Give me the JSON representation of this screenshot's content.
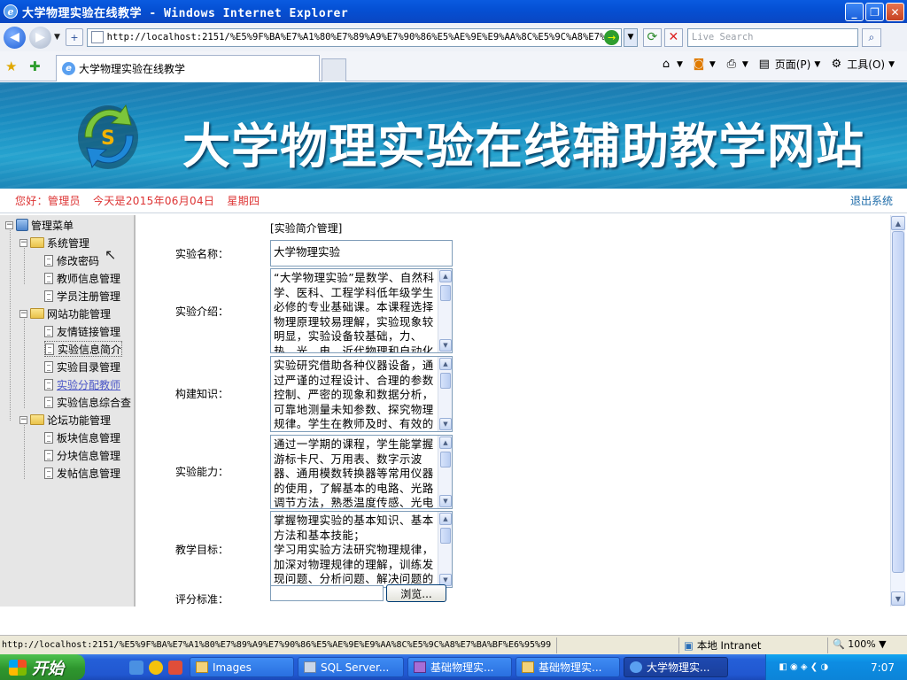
{
  "window": {
    "title": "大学物理实验在线教学 - Windows Internet Explorer",
    "buttons": {
      "minimize": "_",
      "maximize": "❐",
      "close": "✕"
    }
  },
  "address": {
    "url": "http://localhost:2151/%E5%9F%BA%E7%A1%80%E7%89%A9%E7%90%86%E5%AE%9E%E9%AA%8C%E5%9C%A8%E7%BA",
    "search_placeholder": "Live Search"
  },
  "tab": {
    "label": "大学物理实验在线教学"
  },
  "commandbar": {
    "page": "页面(P)",
    "tools": "工具(O)"
  },
  "banner": {
    "title": "大学物理实验在线辅助教学网站"
  },
  "welcome": {
    "greeting": "您好：管理员",
    "date": "今天是2015年06月04日",
    "weekday": "星期四",
    "logout": "退出系统"
  },
  "sidebar": {
    "root": "管理菜单",
    "groups": [
      {
        "label": "系统管理",
        "items": [
          "修改密码",
          "教师信息管理",
          "学员注册管理"
        ]
      },
      {
        "label": "网站功能管理",
        "items": [
          "友情链接管理",
          "实验信息简介",
          "实验目录管理",
          "实验分配教师",
          "实验信息综合查"
        ]
      },
      {
        "label": "论坛功能管理",
        "items": [
          "板块信息管理",
          "分块信息管理",
          "发帖信息管理"
        ]
      }
    ]
  },
  "form": {
    "section_title": "[实验简介管理]",
    "name_label": "实验名称：",
    "name_value": "大学物理实验",
    "intro_label": "实验介绍：",
    "intro_value": "“大学物理实验”是数学、自然科学、医科、工程学科低年级学生必修的专业基础课。本课程选择物理原理较易理解，实验现象较明显，实验设备较基础，力、热、光、电、近代物理和自动化测量技术等方面",
    "knowledge_label": "构建知识：",
    "knowledge_value": "实验研究借助各种仪器设备，通过严谨的过程设计、合理的参数控制、严密的现象和数据分析，可靠地测量未知参数、探究物理规律。学生在教师及时、有效的实验指导下，分析",
    "ability_label": "实验能力：",
    "ability_value": "通过一学期的课程，学生能掌握游标卡尺、万用表、数字示波器、通用模数转换器等常用仪器的使用，了解基本的电路、光路调节方法，熟悉温度传感、光电探测等实验技能",
    "goal_label": "教学目标：",
    "goal_value": "掌握物理实验的基本知识、基本方法和基本技能；\n学习用实验方法研究物理规律，加深对物理规律的理解，训练发现问题、分析问题、解决问题的能力。",
    "score_label": "评分标准：",
    "browse_label": "浏览..."
  },
  "statusbar": {
    "url": "http://localhost:2151/%E5%9F%BA%E7%A1%80%E7%89%A9%E7%90%86%E5%AE%9E%E9%AA%8C%E5%9C%A8%E7%BA%BF%E6%95%99",
    "zone": "本地 Intranet",
    "zoom": "100%"
  },
  "taskbar": {
    "start": "开始",
    "buttons": [
      "Images",
      "SQL Server...",
      "基础物理实...",
      "基础物理实...",
      "大学物理实..."
    ],
    "clock": "7:07"
  },
  "colors": {
    "titlebar": "#0a5be0",
    "banner": "#1a8cc0",
    "welcome_text": "#dd3333",
    "link": "#1b6aa8"
  }
}
